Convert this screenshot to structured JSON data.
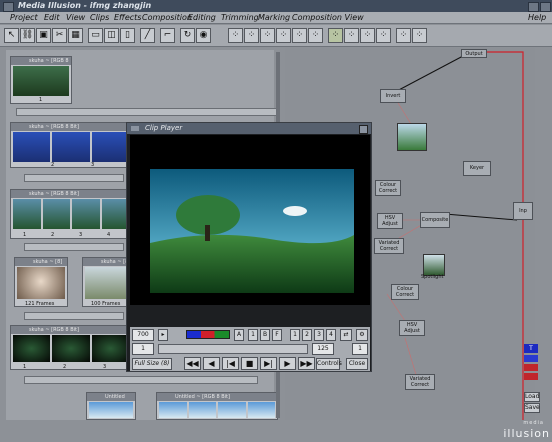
{
  "window": {
    "title": "Media Illusion - ifmg zhangjin"
  },
  "menu": [
    "Project",
    "Edit",
    "View",
    "Clips",
    "Effects",
    "Composition",
    "Editing",
    "Trimming",
    "Marking",
    "Composition View",
    "Help"
  ],
  "bin": {
    "clips": [
      {
        "title": "skuha ~ [RGB 8 Bit]",
        "frame_labels": [
          "1"
        ]
      },
      {
        "title": "skuha ~ [RGB 8 Bit]",
        "frame_labels": [
          "2",
          "3"
        ]
      },
      {
        "title": "skuha ~ [RGB 8 Bit]",
        "frame_labels": [
          "1",
          "2",
          "3",
          "4",
          "5"
        ]
      },
      {
        "title": "skuha ~ [8]",
        "frame_labels": [
          "121 Frames"
        ]
      },
      {
        "title": "skuha ~ [8]",
        "frame_labels": [
          "100 Frames"
        ]
      },
      {
        "title": "skuha ~ [RGB 8 Bit]",
        "frame_labels": [
          "1",
          "2",
          "3"
        ]
      },
      {
        "title": "Untitled",
        "frame_labels": []
      },
      {
        "title": "Untitled ~ [RGB 8 Bit]",
        "frame_labels": []
      }
    ]
  },
  "player": {
    "title": "Clip Player",
    "frame_field": "700",
    "field2": "1",
    "end_field": "125",
    "end_field2": "1",
    "pane_buttons": [
      "A",
      "1",
      "B",
      "F"
    ],
    "num_buttons": [
      "1",
      "2",
      "3",
      "4"
    ],
    "size_label": "Full Size (8)",
    "transport": [
      "◀◀",
      "◀",
      "|◀",
      "■",
      "▶|",
      "▶",
      "▶▶"
    ],
    "controls_label": "Controls",
    "close_label": "Close"
  },
  "nodes": [
    {
      "id": "output",
      "label": "Output"
    },
    {
      "id": "invert",
      "label": "Invert"
    },
    {
      "id": "keyer",
      "label": "Keyer"
    },
    {
      "id": "colour-correct-1",
      "label": "Colour Correct"
    },
    {
      "id": "hsv-adjust-1",
      "label": "HSV Adjust"
    },
    {
      "id": "composite",
      "label": "Composite"
    },
    {
      "id": "variated-correct-1",
      "label": "Variated Correct"
    },
    {
      "id": "colour-correct-2",
      "label": "Colour Correct"
    },
    {
      "id": "hsv-adjust-2",
      "label": "HSV Adjust"
    },
    {
      "id": "variated-correct-2",
      "label": "Variated Correct"
    },
    {
      "id": "spotlight",
      "label": "Spotlight"
    },
    {
      "id": "inp",
      "label": "Inp"
    }
  ],
  "rightbar": {
    "buttons": [
      "T",
      "Load",
      "Save"
    ]
  },
  "logo": {
    "small": "media",
    "big": "illusion"
  },
  "colors": {
    "accent": "#c2262c",
    "panel": "#a5a9af",
    "title": "#3f4b5c"
  }
}
